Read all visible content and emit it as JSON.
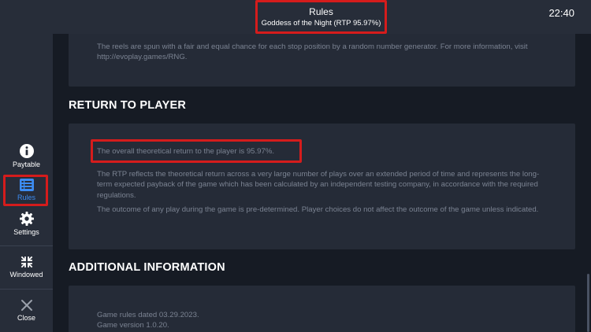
{
  "header": {
    "title": "Rules",
    "subtitle": "Goddess of the Night (RTP 95.97%)",
    "time": "22:40"
  },
  "sidebar": {
    "items": [
      {
        "label": "Paytable",
        "icon": "info-icon"
      },
      {
        "label": "Rules",
        "icon": "list-icon",
        "active": true
      },
      {
        "label": "Settings",
        "icon": "gear-icon"
      },
      {
        "label": "Windowed",
        "icon": "collapse-icon"
      },
      {
        "label": "Close",
        "icon": "close-icon"
      }
    ]
  },
  "content": {
    "rng_text": "The reels are spun with a fair and equal chance for each stop position by a random number generator. For more information, visit http://evoplay.games/RNG.",
    "rtp_heading": "RETURN TO PLAYER",
    "rtp_highlight": "The overall theoretical return to the player is 95.97%.",
    "rtp_description": "The RTP reflects the theoretical return across a very large number of plays over an extended period of time and represents the long-term expected payback of the game which has been calculated by an independent testing company, in accordance with the required regulations.",
    "rtp_outcome": "The outcome of any play during the game is pre-determined. Player choices do not affect the outcome of the game unless indicated.",
    "additional_heading": "ADDITIONAL INFORMATION",
    "rules_date": "Game rules dated 03.29.2023.",
    "version": "Game version 1.0.20."
  },
  "colors": {
    "highlight": "#d51c1c",
    "accent": "#3c8cf2",
    "panel": "#252b37",
    "background": "#161b24"
  }
}
